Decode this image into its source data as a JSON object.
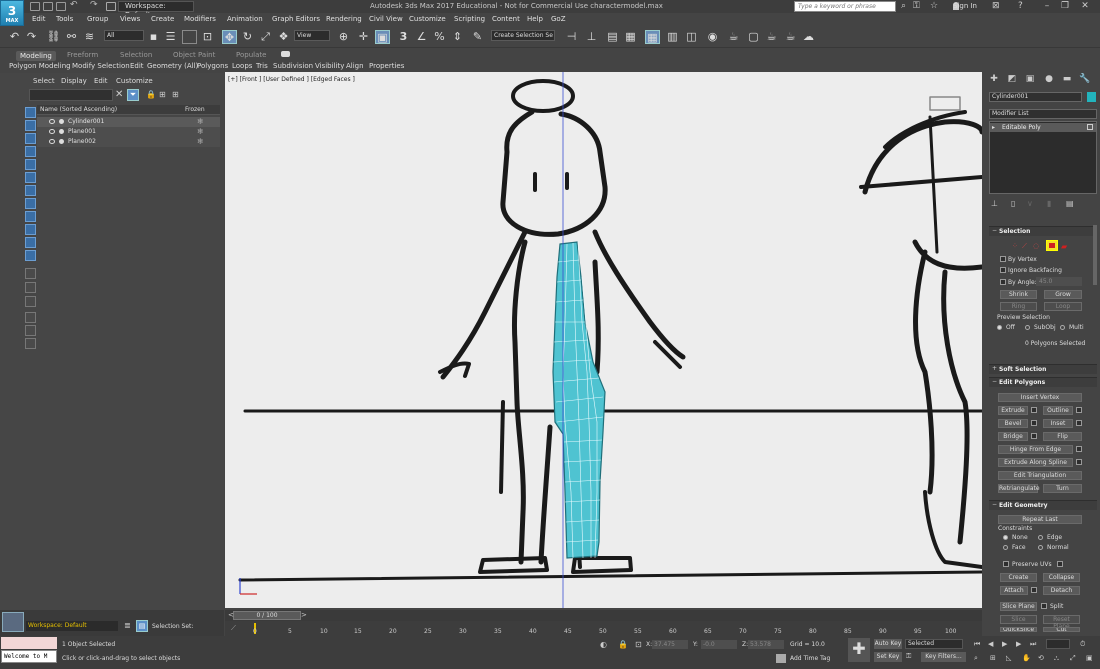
{
  "app": {
    "logo_text": "3",
    "logo_sub": "MAX",
    "workspace": "Workspace: Default",
    "window_title": "Autodesk 3ds Max 2017 Educational - Not for Commercial Use   charactermodel.max",
    "search_placeholder": "Type a keyword or phrase",
    "signin": "Sign In"
  },
  "menus": [
    "Edit",
    "Tools",
    "Group",
    "Views",
    "Create",
    "Modifiers",
    "Animation",
    "Graph Editors",
    "Rendering",
    "Civil View",
    "Customize",
    "Scripting",
    "Content",
    "Help",
    "GoZ"
  ],
  "toolbar": {
    "filter_dd": "All",
    "view_dd": "View",
    "selection_set": "Create Selection Se",
    "snap_label": "3",
    "angle_label": "%"
  },
  "ribbon": {
    "tabs": [
      "Modeling",
      "Freeform",
      "Selection",
      "Object Paint",
      "Populate"
    ],
    "subtabs": [
      "Polygon Modeling",
      "Modify Selection",
      "Edit",
      "Geometry (All)",
      "Polygons",
      "Loops",
      "Tris",
      "Subdivision",
      "Visibility",
      "Align",
      "Properties"
    ]
  },
  "scene_explorer": {
    "menu": [
      "Select",
      "Display",
      "Edit",
      "Customize"
    ],
    "header_name": "Name (Sorted Ascending)",
    "header_frozen": "Frozen",
    "rows": [
      {
        "name": "Cylinder001",
        "frozen": "❄",
        "selected": true
      },
      {
        "name": "Plane001",
        "frozen": "❄",
        "selected": false
      },
      {
        "name": "Plane002",
        "frozen": "❄",
        "selected": false
      }
    ]
  },
  "viewport": {
    "label": "[+] [Front ] [User Defined ] [Edged Faces ]"
  },
  "command_panel": {
    "object_name": "Cylinder001",
    "object_color": "#22b4bd",
    "modifier_list": "Modifier List",
    "stack_item": "Editable Poly",
    "selection": {
      "title": "Selection",
      "by_vertex": "By Vertex",
      "ignore_backfacing": "Ignore Backfacing",
      "by_angle": "By Angle:",
      "angle_value": "45.0",
      "shrink": "Shrink",
      "grow": "Grow",
      "ring": "Ring",
      "loop": "Loop",
      "preview": "Preview Selection",
      "off": "Off",
      "subobj": "SubObj",
      "multi": "Multi",
      "count": "0 Polygons Selected"
    },
    "soft_selection": "Soft Selection",
    "edit_polygons": {
      "title": "Edit Polygons",
      "insert_vertex": "Insert Vertex",
      "extrude": "Extrude",
      "outline": "Outline",
      "bevel": "Bevel",
      "inset": "Inset",
      "bridge": "Bridge",
      "flip": "Flip",
      "hinge": "Hinge From Edge",
      "extrude_spline": "Extrude Along Spline",
      "edit_tri": "Edit Triangulation",
      "retriangulate": "Retriangulate",
      "turn": "Turn"
    },
    "edit_geometry": {
      "title": "Edit Geometry",
      "repeat_last": "Repeat Last",
      "constraints": "Constraints",
      "none": "None",
      "edge": "Edge",
      "face": "Face",
      "normal": "Normal",
      "preserve_uvs": "Preserve UVs",
      "create": "Create",
      "collapse": "Collapse",
      "attach": "Attach",
      "detach": "Detach",
      "slice_plane": "Slice Plane",
      "split": "Split",
      "slice": "Slice",
      "reset_plane": "Reset Plane",
      "quickslice": "QuickSlice",
      "cut": "Cut"
    }
  },
  "timeline": {
    "slider": "0 / 100",
    "ticks": [
      "0",
      "5",
      "10",
      "15",
      "20",
      "25",
      "30",
      "35",
      "40",
      "45",
      "50",
      "55",
      "60",
      "65",
      "70",
      "75",
      "80",
      "85",
      "90",
      "95",
      "100"
    ]
  },
  "status": {
    "workspace": "Workspace: Default",
    "selection_set": "Selection Set:",
    "maxscript": "Welcome to M",
    "objects_selected": "1 Object Selected",
    "prompt": "Click or click-and-drag to select objects",
    "x_label": "X:",
    "x_value": "37.475",
    "y_label": "Y:",
    "y_value": "-0.0",
    "z_label": "Z:",
    "z_value": "53.578",
    "grid": "Grid = 10.0",
    "add_time_tag": "Add Time Tag",
    "auto_key": "Auto Key",
    "selected_dd": "Selected",
    "set_key": "Set Key",
    "key_filters": "Key Filters..."
  }
}
